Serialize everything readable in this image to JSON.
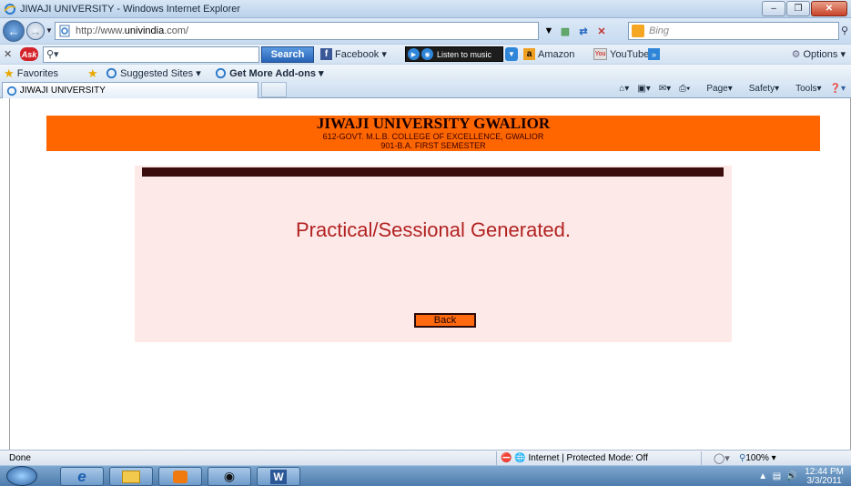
{
  "window": {
    "title": "JIWAJI UNIVERSITY - Windows Internet Explorer",
    "minimize_glyph": "–",
    "maximize_glyph": "❐",
    "close_glyph": "✕"
  },
  "addressbar": {
    "url_prefix": "http://www.",
    "url_domain": "univindia",
    "url_suffix": ".com/",
    "search_placeholder": "Bing"
  },
  "asktoolbar": {
    "ask_logo": "Ask",
    "search_button": "Search",
    "facebook": "Facebook",
    "music": "Listen to music",
    "amazon": "Amazon",
    "youtube": "YouTube",
    "options": "Options"
  },
  "favorites": {
    "favorites_label": "Favorites",
    "suggested_sites": "Suggested Sites",
    "get_addons": "Get More Add-ons"
  },
  "tab": {
    "label": "JIWAJI UNIVERSITY"
  },
  "commandbar": {
    "page": "Page",
    "safety": "Safety",
    "tools": "Tools"
  },
  "page": {
    "university_name": "JIWAJI UNIVERSITY GWALIOR",
    "college": "612-GOVT. M.L.B. COLLEGE OF EXCELLENCE, GWALIOR",
    "course": "901-B.A. FIRST SEMESTER",
    "message": "Practical/Sessional Generated.",
    "back_button": "Back"
  },
  "statusbar": {
    "status": "Done",
    "zone": "Internet | Protected Mode: Off",
    "zoom": "100%"
  },
  "taskbar": {
    "time": "12:44 PM",
    "date": "3/3/2011"
  },
  "colors": {
    "header_orange": "#ff6600",
    "panel_pink": "#fde9e8",
    "message_red": "#b22222",
    "dark_bar": "#3b0d0d"
  }
}
